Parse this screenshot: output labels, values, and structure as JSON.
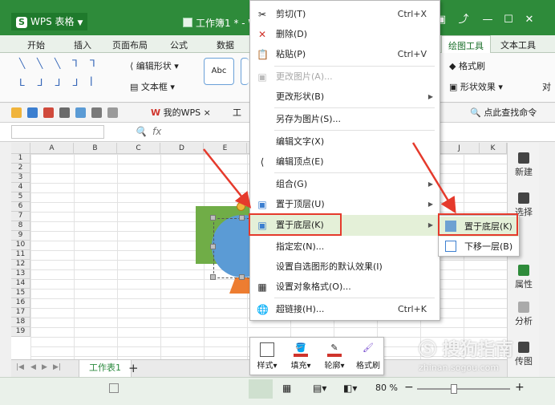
{
  "app": {
    "name": "WPS 表格",
    "doc_title": "工作簿1 * - W"
  },
  "tabs": [
    "开始",
    "插入",
    "页面布局",
    "公式",
    "数据"
  ],
  "contextual_tabs": [
    "绘图工具",
    "文本工具"
  ],
  "ribbon": {
    "edit_shape": "编辑形状",
    "text_box": "文本框",
    "abc": "Abc",
    "format_painter": "格式刷",
    "shape_effect": "形状效果",
    "align_short": "对"
  },
  "quickbar": {
    "doc_tab_label": "我的WPS",
    "doc_tab_close": "×",
    "doc_tab_partial": "工",
    "find_cmd": "点此查找命令"
  },
  "formula_bar": {
    "fx": "fx"
  },
  "columns": [
    "A",
    "B",
    "C",
    "D",
    "E",
    "J",
    "K"
  ],
  "rows": [
    "1",
    "2",
    "3",
    "4",
    "5",
    "6",
    "7",
    "8",
    "9",
    "10",
    "11",
    "12",
    "13",
    "14",
    "15",
    "16",
    "17",
    "18",
    "19"
  ],
  "context_menu": {
    "items": [
      {
        "icon": "scissors-icon",
        "label": "剪切(T)",
        "shortcut": "Ctrl+X"
      },
      {
        "icon": "delete-icon",
        "label": "删除(D)",
        "shortcut": ""
      },
      {
        "icon": "paste-icon",
        "label": "粘贴(P)",
        "shortcut": "Ctrl+V"
      },
      {
        "icon": "change-picture-icon",
        "label": "更改图片(A)...",
        "shortcut": ""
      },
      {
        "icon": "",
        "label": "更改形状(B)",
        "shortcut": ""
      },
      {
        "icon": "",
        "label": "另存为图片(S)...",
        "shortcut": ""
      },
      {
        "icon": "",
        "label": "编辑文字(X)",
        "shortcut": ""
      },
      {
        "icon": "edit-points-icon",
        "label": "编辑顶点(E)",
        "shortcut": ""
      },
      {
        "icon": "",
        "label": "组合(G)",
        "shortcut": ""
      },
      {
        "icon": "bring-to-front-icon",
        "label": "置于顶层(U)",
        "shortcut": ""
      },
      {
        "icon": "send-to-back-icon",
        "label": "置于底层(K)",
        "shortcut": ""
      },
      {
        "icon": "",
        "label": "指定宏(N)...",
        "shortcut": ""
      },
      {
        "icon": "",
        "label": "设置自选图形的默认效果(I)",
        "shortcut": ""
      },
      {
        "icon": "format-object-icon",
        "label": "设置对象格式(O)...",
        "shortcut": ""
      },
      {
        "icon": "hyperlink-icon",
        "label": "超链接(H)...",
        "shortcut": "Ctrl+K"
      }
    ]
  },
  "submenu": {
    "items": [
      "置于底层(K)",
      "下移一层(B)"
    ]
  },
  "mini_toolbar": {
    "items": [
      "样式",
      "填充",
      "轮廓",
      "格式刷"
    ]
  },
  "sheet": {
    "tab": "工作表1",
    "add": "+"
  },
  "status": {
    "zoom": "80 %",
    "zoom_level": 0.4
  },
  "right_pane": [
    "新建",
    "选择",
    "属性",
    "分析",
    "传图"
  ],
  "watermark": {
    "text": "搜狗指南",
    "url": "zhinan.sogou.com"
  }
}
